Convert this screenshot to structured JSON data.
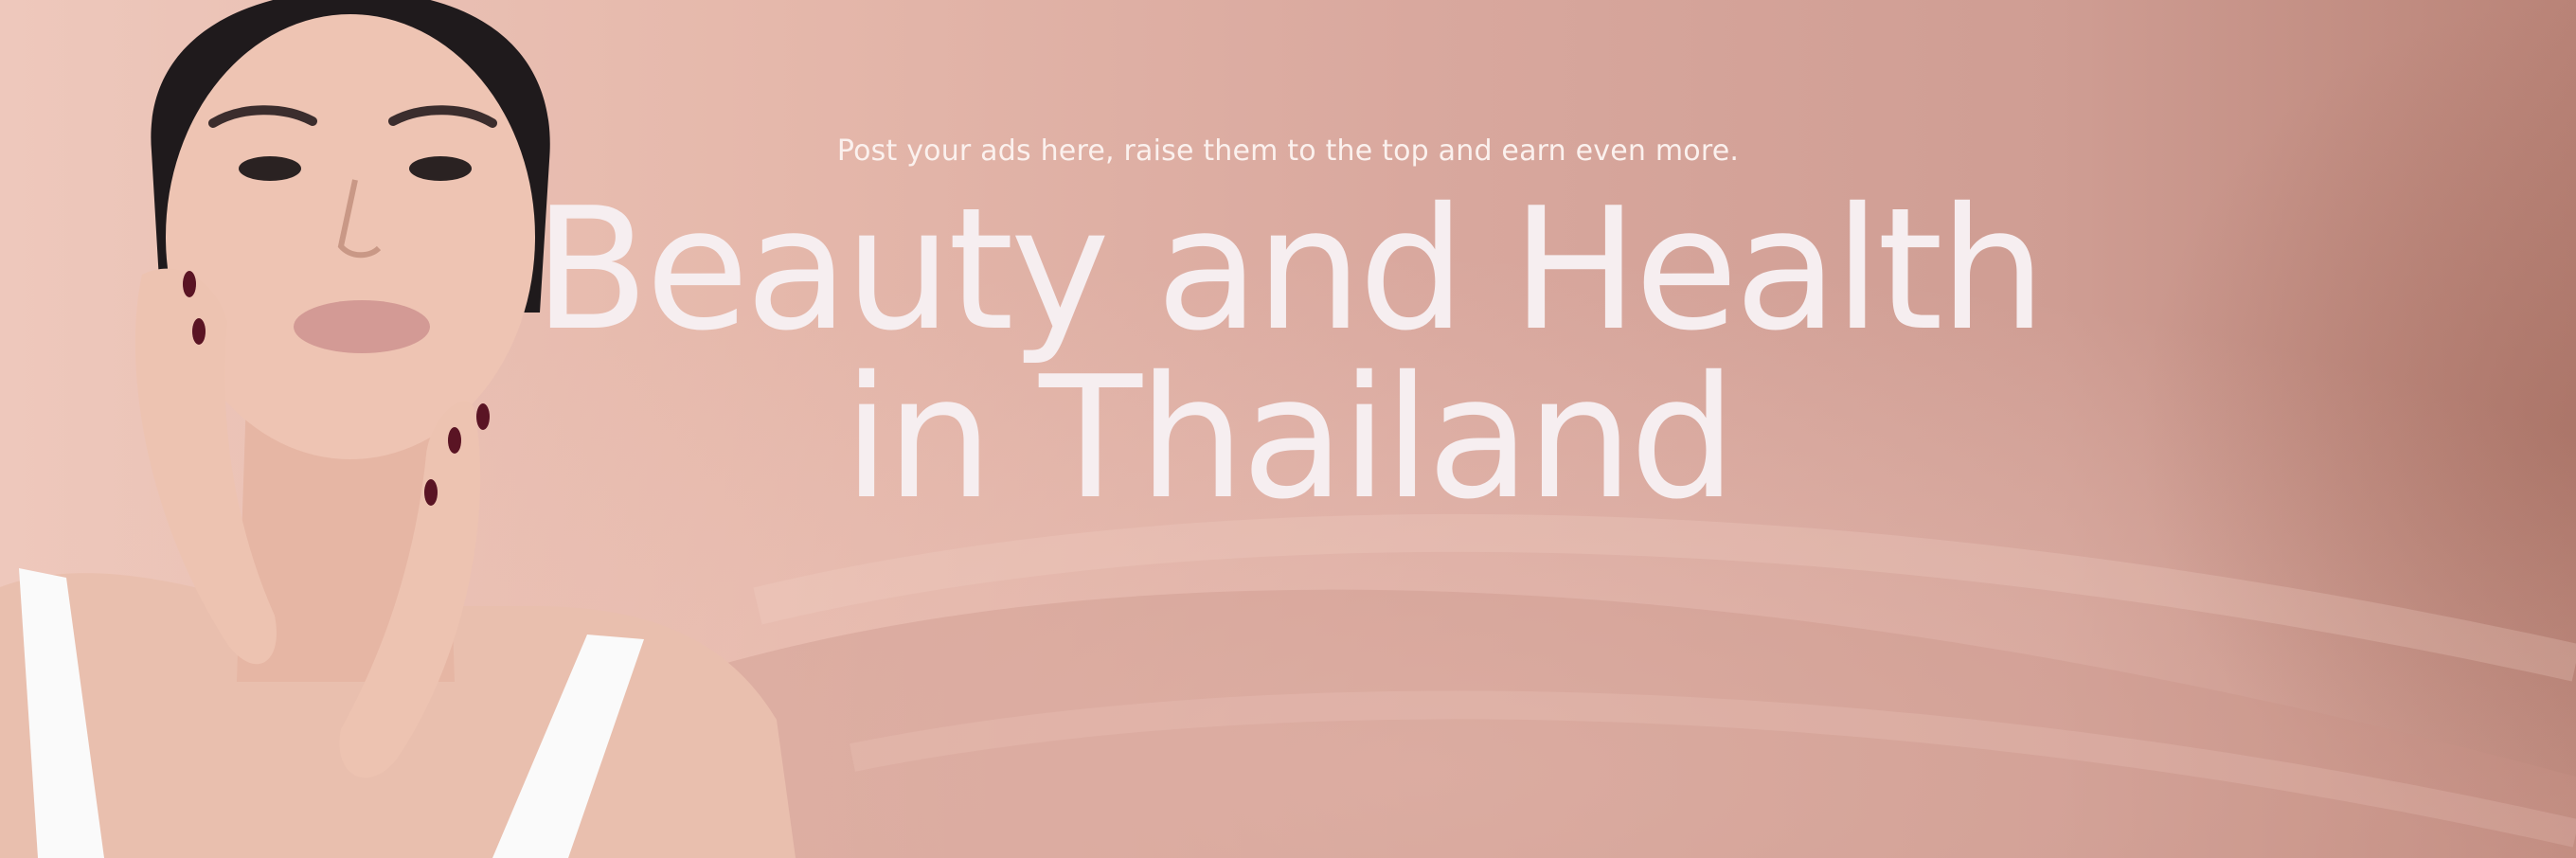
{
  "hero": {
    "subtitle": "Post your ads here, raise them to the top and earn even more.",
    "headline_line1": "Beauty and Health",
    "headline_line2": "in Thailand",
    "image": "woman-portrait-photo"
  },
  "colors": {
    "background_light": "#eec8bc",
    "background_mid": "#d9a89e",
    "background_dark": "#b98377",
    "text": "#f6eef0"
  }
}
